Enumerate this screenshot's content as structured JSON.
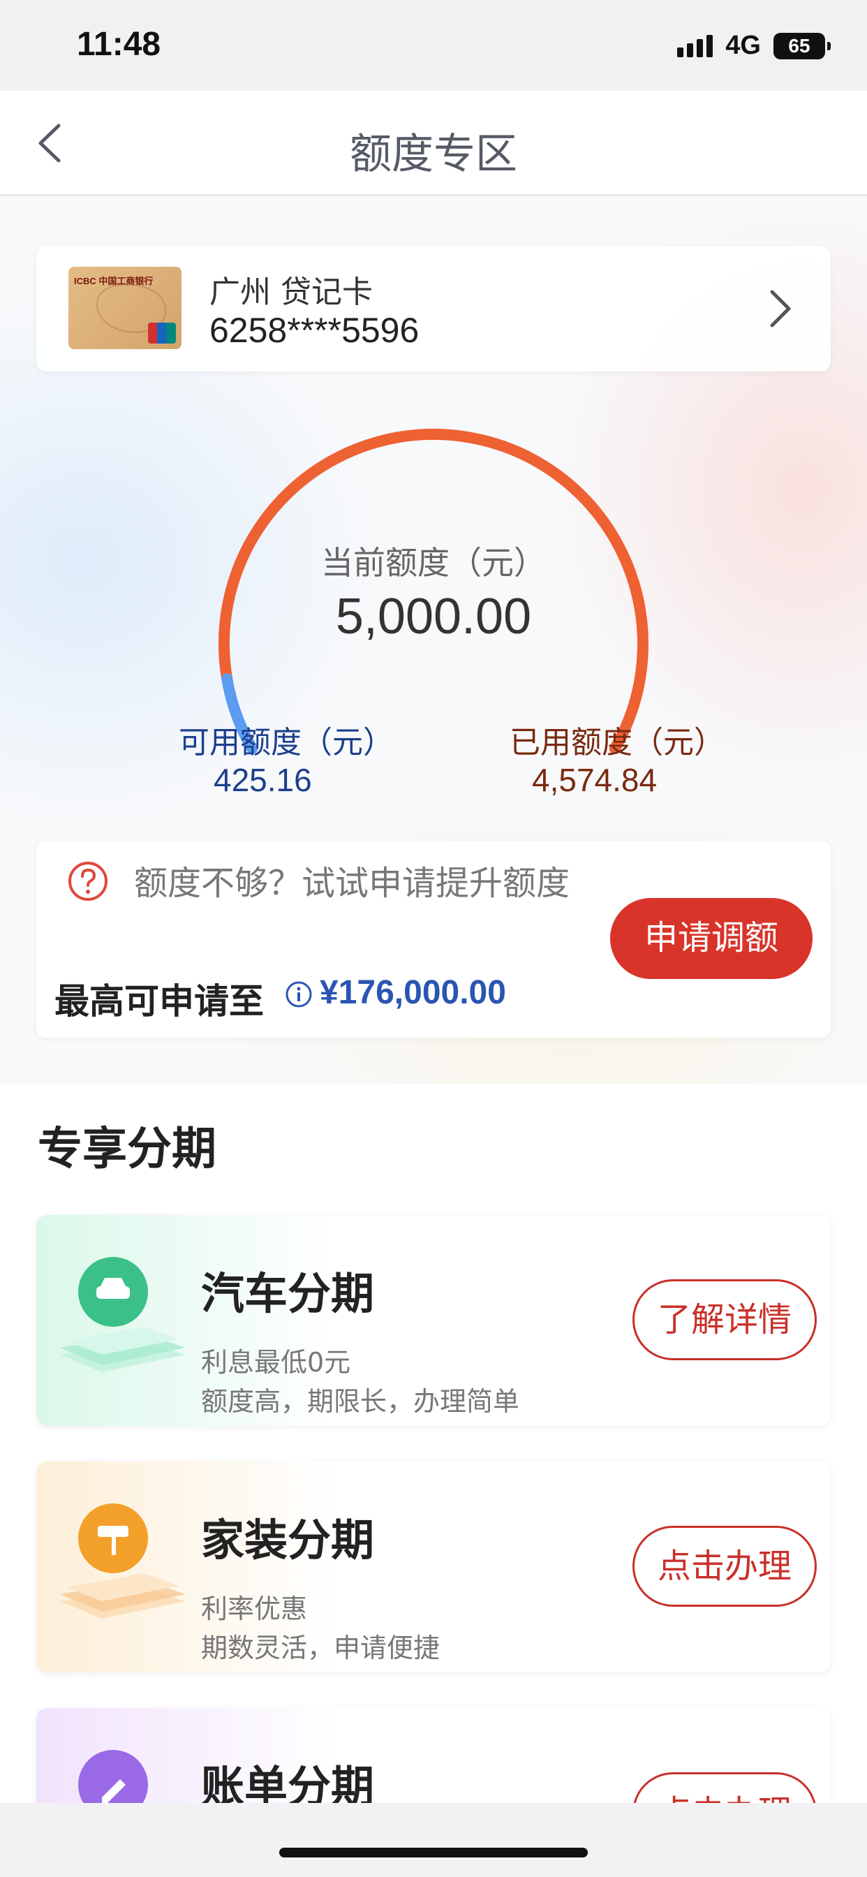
{
  "status_bar": {
    "time": "11:48",
    "network": "4G",
    "battery": "65"
  },
  "nav": {
    "title": "额度专区"
  },
  "card": {
    "name": "广州 贷记卡",
    "number": "6258****5596",
    "thumb_bank_text": "ICBC 中国工商银行"
  },
  "limit": {
    "current_label": "当前额度（元）",
    "current_value": "5,000.00",
    "available_label": "可用额度（元）",
    "available_value": "425.16",
    "used_label": "已用额度（元）",
    "used_value": "4,574.84",
    "available_fraction": 0.085
  },
  "raise": {
    "tip": "额度不够？试试申请提升额度",
    "max_label": "最高可申请至",
    "max_value": "¥176,000.00",
    "apply_label": "申请调额"
  },
  "installments": {
    "title": "专享分期",
    "items": [
      {
        "name": "汽车分期",
        "desc1": "利息最低0元",
        "desc2": "额度高，期限长，办理简单",
        "button": "了解详情",
        "icon": "car-icon",
        "color": "#3cc08a"
      },
      {
        "name": "家装分期",
        "desc1": "利率优惠",
        "desc2": "期数灵活，申请便捷",
        "button": "点击办理",
        "icon": "paint-roller-icon",
        "color": "#f3a02a"
      },
      {
        "name": "账单分期",
        "desc1": "",
        "desc2": "",
        "button": "点击办理",
        "icon": "pen-icon",
        "color": "#9a6ae6"
      }
    ]
  },
  "colors": {
    "arc_used": "#ee6133",
    "arc_available": "#5b9cf0",
    "accent_red": "#d9342a",
    "available_text": "#1d3f8c",
    "used_text": "#7a2a10"
  }
}
